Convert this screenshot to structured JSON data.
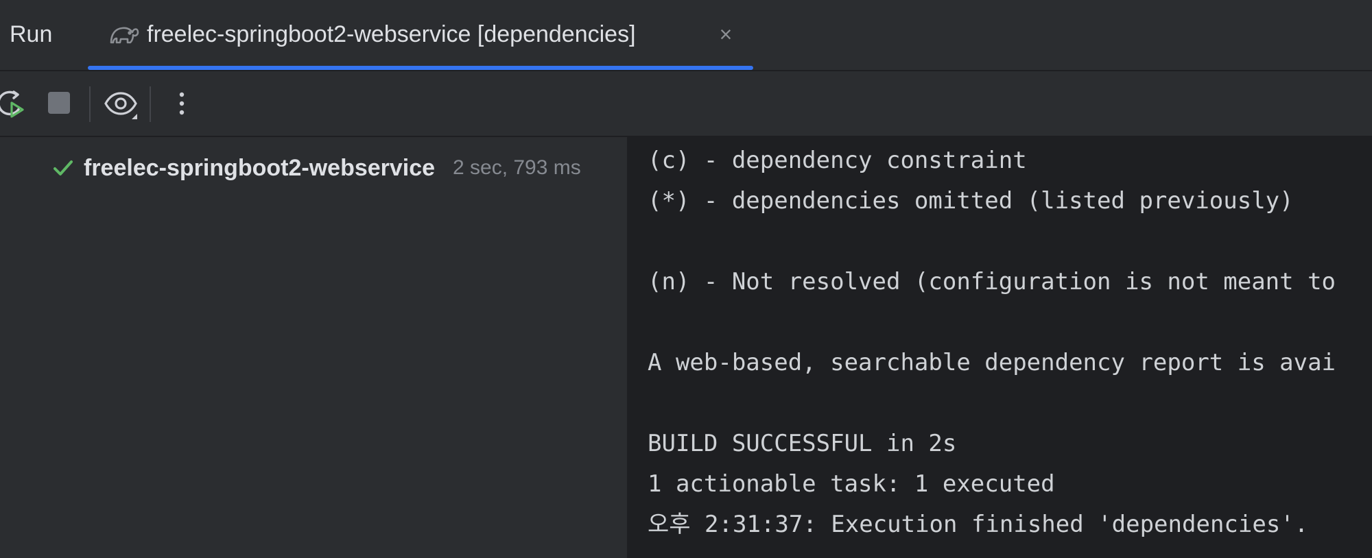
{
  "header": {
    "run_label": "Run",
    "tab": {
      "title": "freelec-springboot2-webservice [dependencies]",
      "icon": "gradle-elephant-icon",
      "close_glyph": "×"
    }
  },
  "toolbar": {
    "buttons": [
      {
        "name": "rerun-icon"
      },
      {
        "name": "stop-icon"
      },
      {
        "name": "eye-icon"
      },
      {
        "name": "more-options-icon"
      }
    ]
  },
  "tree": {
    "items": [
      {
        "status_icon": "check-icon",
        "name": "freelec-springboot2-webservice",
        "time": "2 sec, 793 ms"
      }
    ]
  },
  "console": {
    "lines": [
      "(c) - dependency constraint",
      "(*) - dependencies omitted (listed previously)",
      "",
      "(n) - Not resolved (configuration is not meant to",
      "",
      "A web-based, searchable dependency report is avai",
      "",
      "BUILD SUCCESSFUL in 2s",
      "1 actionable task: 1 executed",
      "오후 2:31:37: Execution finished 'dependencies'."
    ]
  },
  "colors": {
    "accent": "#3574f0",
    "success": "#5fb865",
    "panel_bg": "#2b2d30",
    "console_bg": "#1e1f22"
  }
}
